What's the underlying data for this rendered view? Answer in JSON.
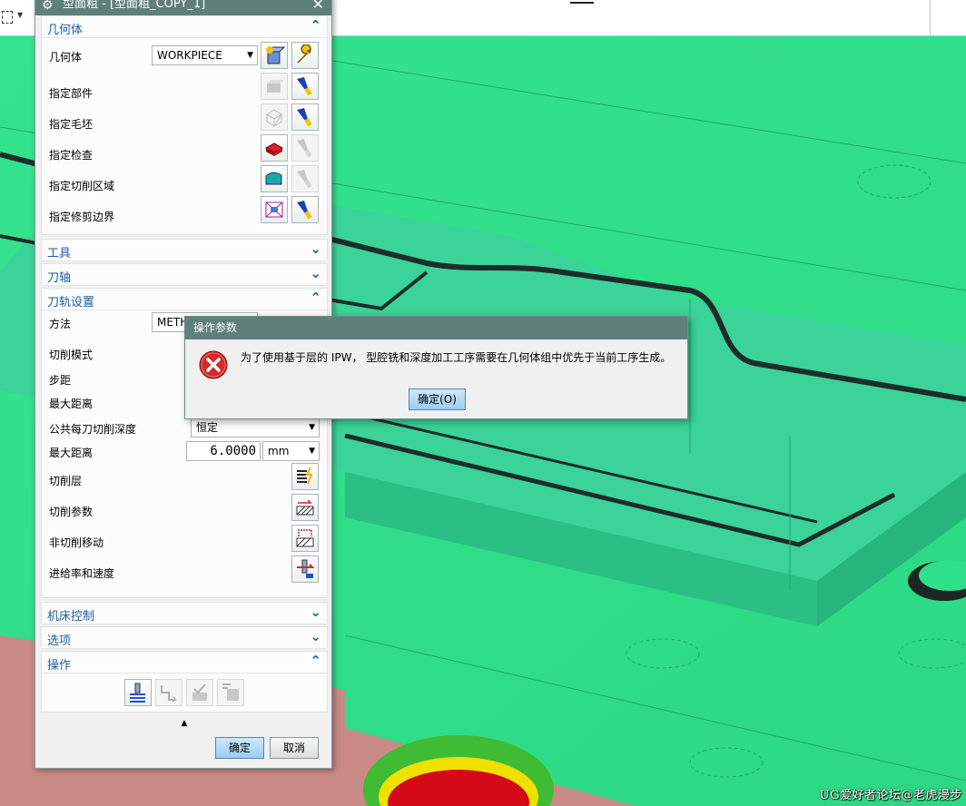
{
  "dialog": {
    "title": "型面粗 - [型面粗_COPY_1]",
    "sections": {
      "geometry": {
        "title": "几何体",
        "geometry_label": "几何体",
        "geometry_value": "WORKPIECE",
        "specify_part": "指定部件",
        "specify_blank": "指定毛坯",
        "specify_check": "指定检查",
        "specify_cut_area": "指定切削区域",
        "specify_trim_boundary": "指定修剪边界"
      },
      "tool": {
        "title": "工具"
      },
      "tool_axis": {
        "title": "刀轴"
      },
      "path_settings": {
        "title": "刀轨设置",
        "method_label": "方法",
        "method_value": "METH",
        "cut_pattern": "切削模式",
        "stepover": "步距",
        "max_distance_1": "最大距离",
        "common_depth_label": "公共每刀切削深度",
        "common_depth_value": "恒定",
        "max_distance_2": "最大距离",
        "max_distance_value": "6.0000",
        "unit": "mm",
        "cut_levels": "切削层",
        "cut_params": "切削参数",
        "non_cut_moves": "非切削移动",
        "feeds_speeds": "进给率和速度"
      },
      "machine_control": {
        "title": "机床控制"
      },
      "options": {
        "title": "选项"
      },
      "actions": {
        "title": "操作"
      }
    },
    "ok_label": "确定",
    "cancel_label": "取消"
  },
  "message_box": {
    "title": "操作参数",
    "message": "为了使用基于层的 IPW， 型腔铣和深度加工工序需要在几何体组中优先于当前工序生成。",
    "ok_label": "确定(O)"
  },
  "watermark": "UG爱好者论坛@老虎漫步",
  "colors": {
    "title_bar": "#5f7f7a",
    "section_header_text": "#1f5da3",
    "model_green": "#2ee08a",
    "floor_pink": "#c98a86",
    "error_red": "#d42a2a"
  }
}
